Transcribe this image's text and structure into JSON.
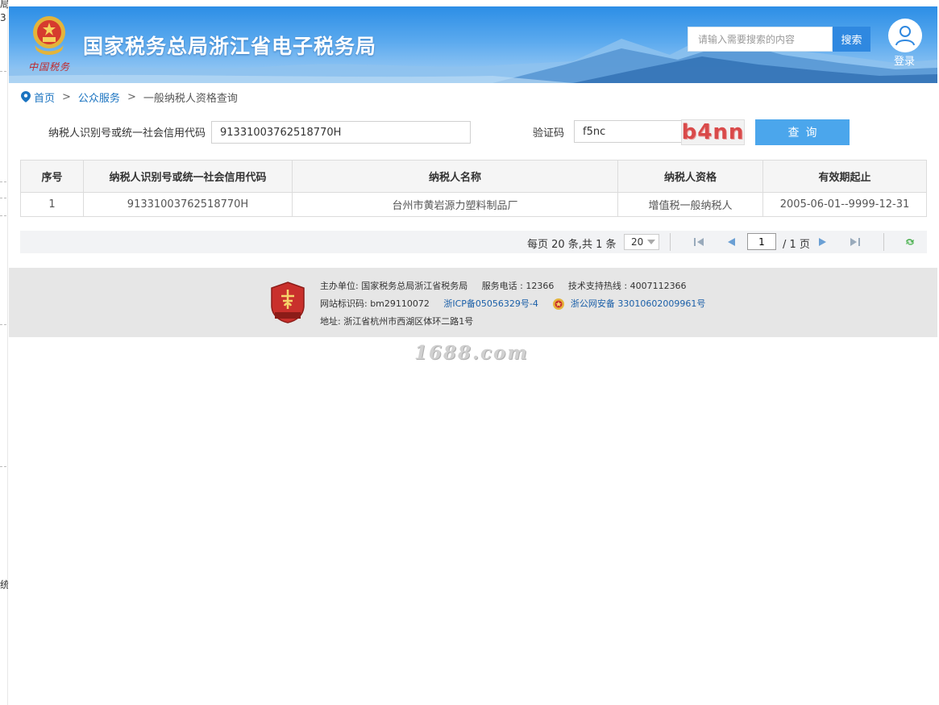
{
  "gutter": {
    "frags": [
      "局",
      "3",
      "统"
    ]
  },
  "header": {
    "logo_subtitle": "中国税务",
    "site_title": "国家税务总局浙江省电子税务局",
    "search_placeholder": "请输入需要搜索的内容",
    "search_button": "搜索",
    "login_label": "登录"
  },
  "breadcrumb": {
    "home": "首页",
    "sep1": ">",
    "section": "公众服务",
    "sep2": ">",
    "current": "一般纳税人资格查询"
  },
  "form": {
    "taxpayer_id_label": "纳税人识别号或统一社会信用代码",
    "taxpayer_id_value": "91331003762518770H",
    "captcha_label": "验证码",
    "captcha_value": "f5nc",
    "captcha_image_text": "b4nn",
    "query_button": "查询"
  },
  "table": {
    "headers": [
      "序号",
      "纳税人识别号或统一社会信用代码",
      "纳税人名称",
      "纳税人资格",
      "有效期起止"
    ],
    "rows": [
      [
        "1",
        "91331003762518770H",
        "台州市黄岩源力塑料制品厂",
        "增值税一般纳税人",
        "2005-06-01--9999-12-31"
      ]
    ]
  },
  "pager": {
    "info": "每页 20 条,共 1 条",
    "page_size": "20",
    "current_page": "1",
    "total_pages": "/ 1 页"
  },
  "footer": {
    "badge_text": "党政机关",
    "line1_sponsor": "主办单位: 国家税务总局浙江省税务局",
    "line1_phone": "服务电话 : 12366",
    "line1_hotline": "技术支持热线 : 4007112366",
    "line2_site_id": "网站标识码: bm29110072",
    "line2_icp": "浙ICP备05056329号-4",
    "line2_police": "浙公网安备 33010602009961号",
    "line3_address": "地址: 浙江省杭州市西湖区体环二路1号"
  },
  "watermark": "1688.com",
  "colors": {
    "header_blue": "#2c8ee6",
    "search_button": "#2f88e0",
    "query_button": "#4ba6ec",
    "link_blue": "#1a73c0",
    "footer_bg": "#e6e6e6"
  }
}
